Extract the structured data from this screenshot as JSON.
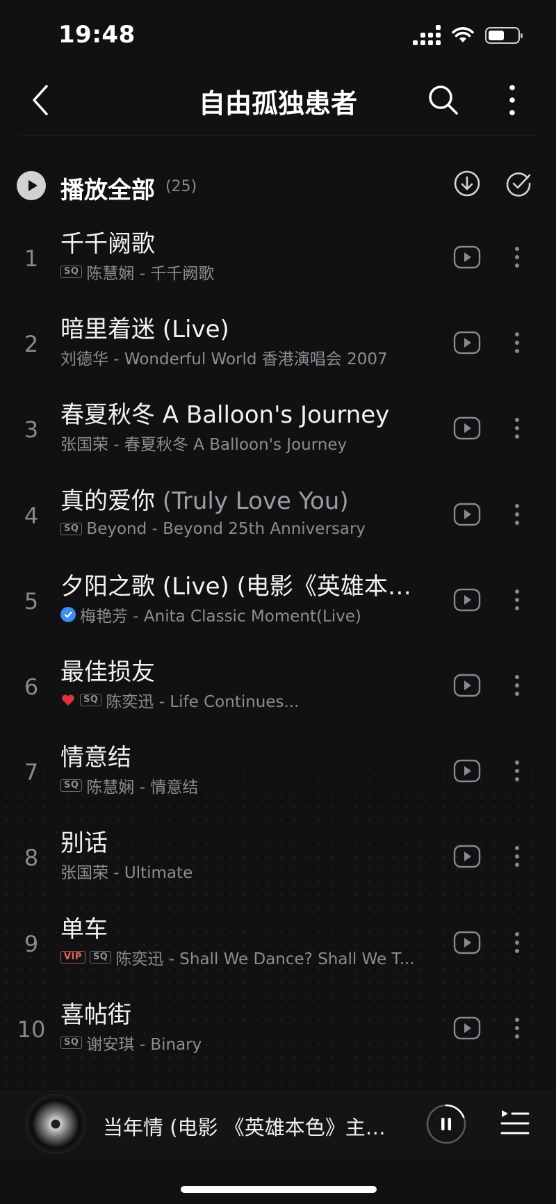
{
  "status_bar": {
    "time": "19:48",
    "battery_level": 0.55
  },
  "nav": {
    "title": "自由孤独患者",
    "back_icon": "chevron-left-icon",
    "search_icon": "search-icon",
    "more_icon": "more-vertical-icon"
  },
  "play_all": {
    "label": "播放全部",
    "count": "(25)"
  },
  "songs": [
    {
      "index": "1",
      "title": "千千阙歌",
      "title_suffix": "",
      "badges": [
        "SQ"
      ],
      "subtitle": "陈慧娴 - 千千阙歌"
    },
    {
      "index": "2",
      "title": "暗里着迷 (Live)",
      "title_suffix": "",
      "badges": [],
      "subtitle": "刘德华 - Wonderful World 香港演唱会 2007"
    },
    {
      "index": "3",
      "title": "春夏秋冬 A Balloon's Journey",
      "title_suffix": "",
      "badges": [],
      "subtitle": "张国荣 - 春夏秋冬 A Balloon's Journey"
    },
    {
      "index": "4",
      "title": "真的爱你",
      "title_suffix": " (Truly Love You)",
      "badges": [
        "SQ"
      ],
      "subtitle": "Beyond - Beyond 25th Anniversary"
    },
    {
      "index": "5",
      "title": "夕阳之歌 (Live) (电影《英雄本…",
      "title_suffix": "",
      "badges": [
        "check"
      ],
      "subtitle": "梅艳芳 - Anita Classic Moment(Live)"
    },
    {
      "index": "6",
      "title": "最佳损友",
      "title_suffix": "",
      "badges": [
        "heart",
        "SQ"
      ],
      "subtitle": "陈奕迅 - Life Continues..."
    },
    {
      "index": "7",
      "title": "情意结",
      "title_suffix": "",
      "badges": [
        "SQ"
      ],
      "subtitle": "陈慧娴 - 情意结"
    },
    {
      "index": "8",
      "title": "别话",
      "title_suffix": "",
      "badges": [],
      "subtitle": "张国荣 - Ultimate"
    },
    {
      "index": "9",
      "title": "单车",
      "title_suffix": "",
      "badges": [
        "VIP",
        "SQ"
      ],
      "subtitle": "陈奕迅 - Shall We Dance? Shall We T..."
    },
    {
      "index": "10",
      "title": "喜帖街",
      "title_suffix": "",
      "badges": [
        "SQ"
      ],
      "subtitle": "谢安琪 - Binary"
    }
  ],
  "mini_player": {
    "title": "当年情 (电影 《英雄本色》主…",
    "playing": true
  },
  "colors": {
    "background": "#111113",
    "secondary_text": "#8d8d91",
    "vip": "#e06a61",
    "verified": "#3d8ef0",
    "heart": "#e0333d"
  }
}
